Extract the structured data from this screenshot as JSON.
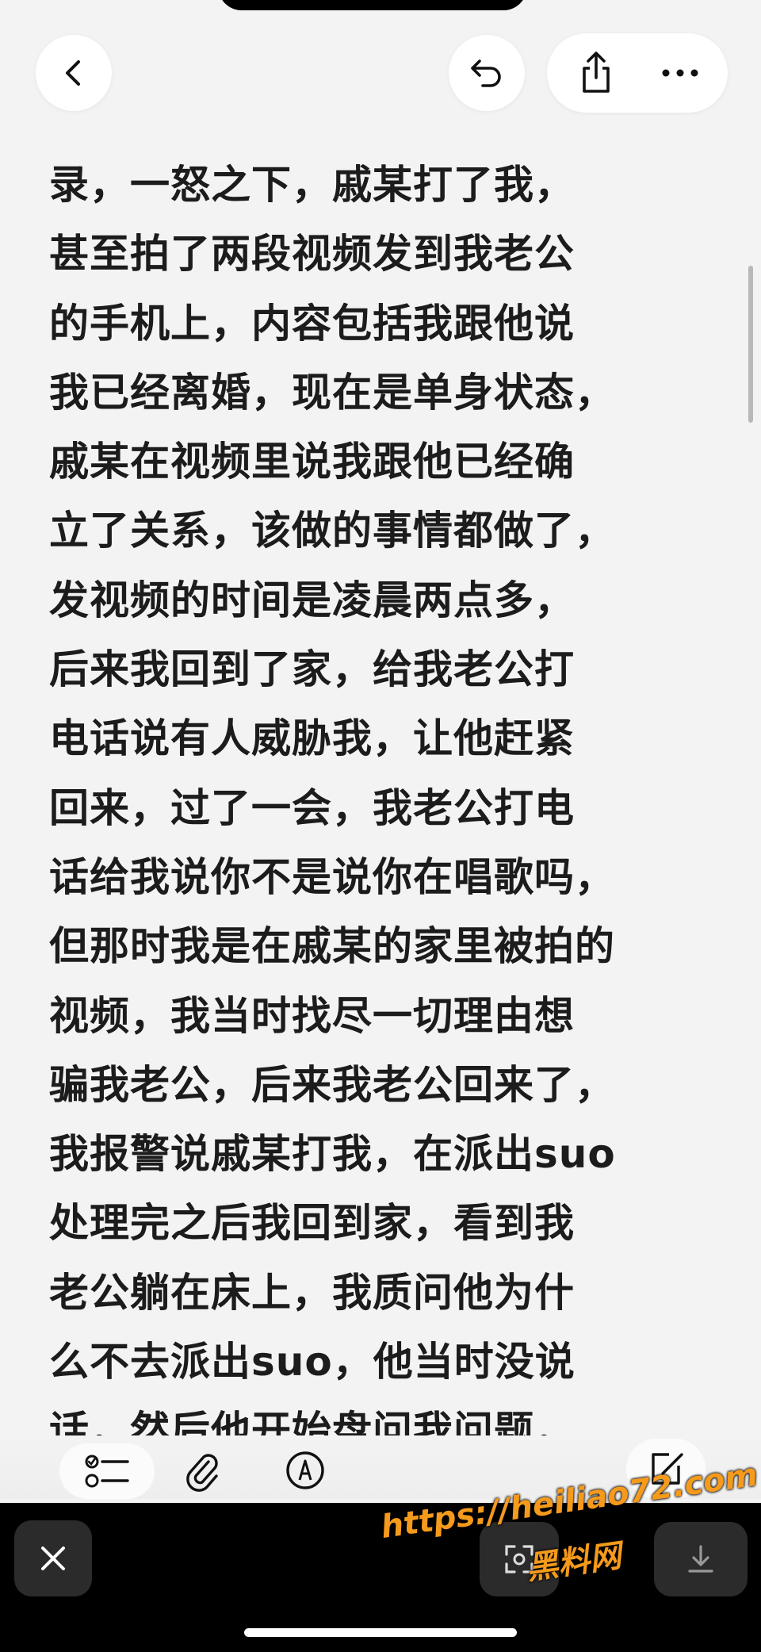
{
  "header": {
    "back_icon": "chevron-left-icon",
    "undo_icon": "undo-icon",
    "share_icon": "share-icon",
    "more_icon": "more-horizontal-icon"
  },
  "note": {
    "lines": [
      "录，一怒之下，戚某打了我，",
      "甚至拍了两段视频发到我老公",
      "的手机上，内容包括我跟他说",
      "我已经离婚，现在是单身状态，",
      "戚某在视频里说我跟他已经确",
      "立了关系，该做的事情都做了，",
      "发视频的时间是凌晨两点多，",
      "后来我回到了家，给我老公打",
      "电话说有人威胁我，让他赶紧",
      "回来，过了一会，我老公打电",
      "话给我说你不是说你在唱歌吗，",
      "但那时我是在戚某的家里被拍的",
      "视频，我当时找尽一切理由想",
      "骗我老公，后来我老公回来了，",
      "我报警说戚某打我，在派出suo",
      "处理完之后我回到家，看到我",
      "老公躺在床上，我质问他为什",
      "么不去派出suo，他当时没说",
      "话，然后他开始盘问我问题，"
    ]
  },
  "toolbar": {
    "checklist_icon": "checklist-icon",
    "attachment_icon": "paperclip-icon",
    "markup_icon": "markup-pen-icon",
    "compose_icon": "compose-icon"
  },
  "bottom_bar": {
    "close_icon": "close-icon",
    "scan_icon": "scan-icon",
    "download_icon": "download-icon"
  },
  "watermark": {
    "url": "https://heiliao72.com",
    "name": "黑料网"
  },
  "colors": {
    "background": "#f3f3f3",
    "text": "#1c1c1c",
    "watermark": "#f59a1b",
    "bottom_bar": "#000000"
  }
}
